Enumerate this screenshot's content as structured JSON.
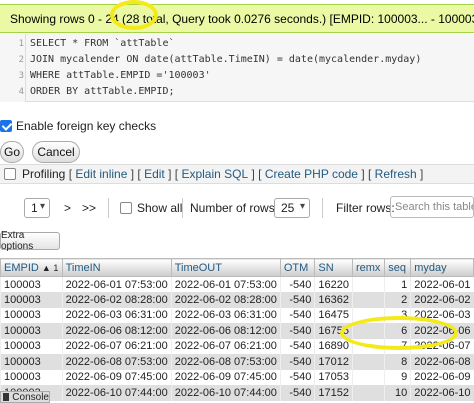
{
  "success": {
    "text": "Showing rows 0 - 24 (28 total, Query took 0.0276 seconds.) [EMPID: 100003... - 100003..."
  },
  "sql": {
    "lines": [
      {
        "num": "1",
        "text": "SELECT * FROM `attTable`"
      },
      {
        "num": "2",
        "text": "JOIN mycalender ON date(attTable.TimeIN) = date(mycalender.myday)"
      },
      {
        "num": "3",
        "text": "WHERE attTable.EMPID ='100003'"
      },
      {
        "num": "4",
        "text": "ORDER BY attTable.EMPID;"
      }
    ]
  },
  "options": {
    "foreign_key_label": "Enable foreign key checks",
    "foreign_key_checked": true,
    "go_label": "Go",
    "cancel_label": "Cancel"
  },
  "profiling": {
    "label": "Profiling",
    "links": [
      "Edit inline",
      "Edit",
      "Explain SQL",
      "Create PHP code",
      "Refresh"
    ]
  },
  "navigation": {
    "page_value": "1",
    "next_label": ">",
    "last_label": ">>",
    "show_all_label": "Show all",
    "rows_label": "Number of rows:",
    "rows_value": "25",
    "filter_label": "Filter rows:",
    "filter_placeholder": "Search this table"
  },
  "extra_options_label": "Extra options",
  "table": {
    "columns": [
      "EMPID",
      "TimeIN",
      "TimeOUT",
      "OTM",
      "SN",
      "remx",
      "seq",
      "myday"
    ],
    "sort_indicator": "▲ 1",
    "rows": [
      [
        "100003",
        "2022-06-01 07:53:00",
        "2022-06-01 07:53:00",
        "-540",
        "16220",
        "",
        "1",
        "2022-06-01"
      ],
      [
        "100003",
        "2022-06-02 08:28:00",
        "2022-06-02 08:28:00",
        "-540",
        "16362",
        "",
        "2",
        "2022-06-02"
      ],
      [
        "100003",
        "2022-06-03 06:31:00",
        "2022-06-03 06:31:00",
        "-540",
        "16475",
        "",
        "3",
        "2022-06-03"
      ],
      [
        "100003",
        "2022-06-06 08:12:00",
        "2022-06-06 08:12:00",
        "-540",
        "16755",
        "",
        "6",
        "2022-06-06"
      ],
      [
        "100003",
        "2022-06-07 06:21:00",
        "2022-06-07 06:21:00",
        "-540",
        "16890",
        "",
        "7",
        "2022-06-07"
      ],
      [
        "100003",
        "2022-06-08 07:53:00",
        "2022-06-08 07:53:00",
        "-540",
        "17012",
        "",
        "8",
        "2022-06-08"
      ],
      [
        "100003",
        "2022-06-09 07:45:00",
        "2022-06-09 07:45:00",
        "-540",
        "17053",
        "",
        "9",
        "2022-06-09"
      ],
      [
        "100003",
        "2022-06-10 07:44:00",
        "2022-06-10 07:44:00",
        "-540",
        "17152",
        "",
        "10",
        "2022-06-10"
      ]
    ]
  },
  "console_label": "Console",
  "colors": {
    "success_bg": "#ebf8a4",
    "highlight": "#f4ea1a",
    "link": "#235a81"
  }
}
